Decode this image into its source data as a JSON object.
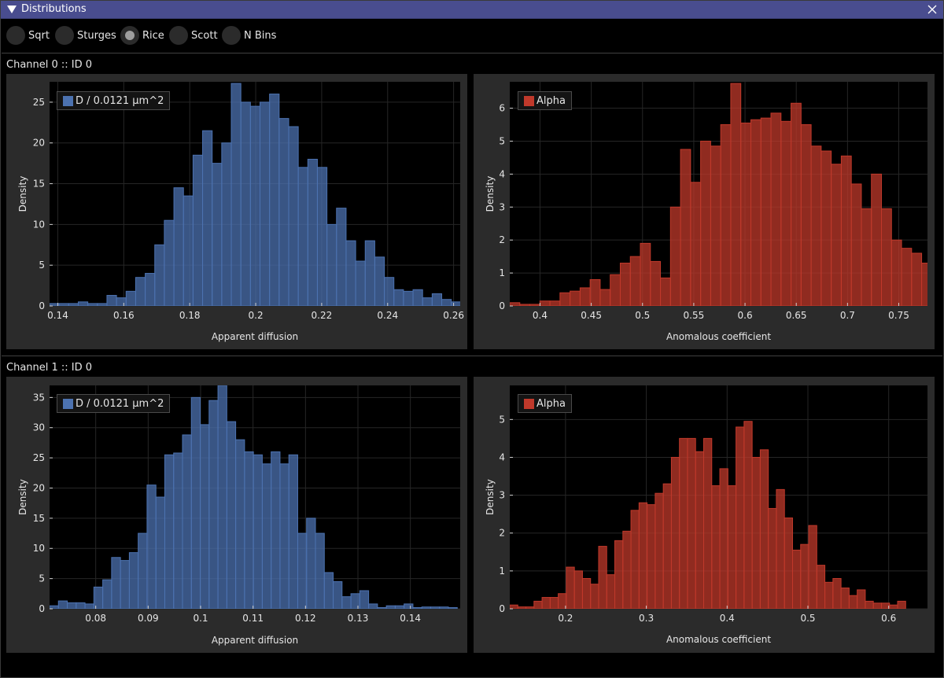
{
  "window": {
    "title": "Distributions"
  },
  "bins_mode": {
    "options": [
      {
        "label": "Sqrt",
        "checked": false
      },
      {
        "label": "Sturges",
        "checked": false
      },
      {
        "label": "Rice",
        "checked": true
      },
      {
        "label": "Scott",
        "checked": false
      },
      {
        "label": "N Bins",
        "checked": false
      }
    ]
  },
  "channels": [
    {
      "label": "Channel 0 :: ID 0"
    },
    {
      "label": "Channel 1 :: ID 0"
    }
  ],
  "colors": {
    "diffusion": "#4c72b0",
    "alpha": "#c0392b"
  },
  "chart_data": [
    {
      "type": "bar",
      "legend": "D / 0.0121 μm^2",
      "xlabel": "Apparent diffusion",
      "ylabel": "Density",
      "xlim": [
        0.1375,
        0.262
      ],
      "ylim": [
        0,
        27.5
      ],
      "xticks": [
        "0.14",
        "0.16",
        "0.18",
        "0.2",
        "0.22",
        "0.24",
        "0.26"
      ],
      "yticks": [
        "0",
        "5",
        "10",
        "15",
        "20",
        "25"
      ],
      "grid": true,
      "legend_position": "top-left",
      "bin_start": 0.1375,
      "bin_width": 0.0029,
      "values": [
        0.3,
        0.3,
        0.3,
        0.5,
        0.3,
        0.3,
        1.3,
        1.0,
        1.8,
        3.5,
        4.0,
        7.5,
        10.5,
        14.5,
        13.5,
        18.5,
        21.5,
        17.5,
        20.0,
        27.3,
        25.0,
        24.5,
        25.0,
        26.0,
        23.0,
        22.0,
        17.0,
        18.0,
        17.0,
        10.0,
        12.0,
        8.0,
        5.5,
        8.0,
        6.0,
        3.5,
        2.0,
        1.8,
        2.0,
        1.0,
        1.5,
        0.8,
        0.5,
        0.5,
        0.3,
        0.3,
        0.3,
        0.3,
        0.3,
        0.1,
        0.3,
        0.3,
        0.3,
        0.3,
        0.3
      ]
    },
    {
      "type": "bar",
      "legend": "Alpha",
      "xlabel": "Anomalous coefficient",
      "ylabel": "Density",
      "xlim": [
        0.3705,
        0.778
      ],
      "ylim": [
        0,
        6.8
      ],
      "xticks": [
        "0.4",
        "0.45",
        "0.5",
        "0.55",
        "0.6",
        "0.65",
        "0.7",
        "0.75"
      ],
      "yticks": [
        "0",
        "1",
        "2",
        "3",
        "4",
        "5",
        "6"
      ],
      "grid": true,
      "legend_position": "top-left",
      "bin_start": 0.3705,
      "bin_width": 0.0098,
      "values": [
        0.1,
        0.05,
        0.05,
        0.15,
        0.15,
        0.4,
        0.45,
        0.55,
        0.8,
        0.5,
        0.95,
        1.3,
        1.5,
        1.9,
        1.35,
        0.85,
        3.0,
        4.75,
        3.75,
        5.0,
        4.85,
        5.5,
        6.75,
        5.55,
        5.65,
        5.7,
        5.85,
        5.6,
        6.15,
        5.5,
        4.85,
        4.7,
        4.3,
        4.55,
        3.7,
        2.95,
        4.0,
        2.95,
        2.0,
        1.75,
        1.6,
        1.3,
        1.0,
        0.95,
        0.4,
        0.55,
        0.7,
        0.6,
        0.2,
        0.05,
        0.05,
        0.1,
        0.05
      ]
    },
    {
      "type": "bar",
      "legend": "D / 0.0121 μm^2",
      "xlabel": "Apparent diffusion",
      "ylabel": "Density",
      "xlim": [
        0.0712,
        0.1495
      ],
      "ylim": [
        0,
        37
      ],
      "xticks": [
        "0.08",
        "0.09",
        "0.1",
        "0.11",
        "0.12",
        "0.13",
        "0.14"
      ],
      "yticks": [
        "0",
        "5",
        "10",
        "15",
        "20",
        "25",
        "30",
        "35"
      ],
      "grid": true,
      "legend_position": "top-left",
      "bin_start": 0.0712,
      "bin_width": 0.00169,
      "values": [
        0.5,
        1.3,
        1.0,
        1.0,
        0.8,
        3.6,
        4.8,
        8.5,
        8.0,
        9.3,
        12.5,
        20.5,
        18.5,
        25.5,
        25.8,
        28.8,
        35.0,
        30.5,
        34.5,
        37.0,
        31.0,
        28.0,
        26.0,
        25.5,
        24.0,
        26.0,
        24.0,
        25.5,
        12.5,
        15.0,
        12.5,
        6.0,
        4.5,
        2.0,
        2.5,
        3.0,
        0.8,
        0.2,
        0.5,
        0.5,
        0.8,
        0.2,
        0.3,
        0.3,
        0.3,
        0.2
      ]
    },
    {
      "type": "bar",
      "legend": "Alpha",
      "xlabel": "Anomalous coefficient",
      "ylabel": "Density",
      "xlim": [
        0.131,
        0.648
      ],
      "ylim": [
        0,
        5.9
      ],
      "xticks": [
        "0.2",
        "0.3",
        "0.4",
        "0.5",
        "0.6"
      ],
      "yticks": [
        "0",
        "1",
        "2",
        "3",
        "4",
        "5"
      ],
      "grid": true,
      "legend_position": "top-left",
      "bin_start": 0.131,
      "bin_width": 0.01,
      "values": [
        0.1,
        0.05,
        0.05,
        0.2,
        0.3,
        0.3,
        0.4,
        1.1,
        1.0,
        0.8,
        0.65,
        1.65,
        0.9,
        1.8,
        2.05,
        2.6,
        2.8,
        2.75,
        3.05,
        3.3,
        4.0,
        4.5,
        4.5,
        4.15,
        4.5,
        3.25,
        3.7,
        3.25,
        4.8,
        4.95,
        4.0,
        4.2,
        2.65,
        3.15,
        2.4,
        1.55,
        1.7,
        2.2,
        1.15,
        0.7,
        0.8,
        0.55,
        0.35,
        0.5,
        0.2,
        0.15,
        0.15,
        0.1,
        0.2
      ]
    }
  ]
}
